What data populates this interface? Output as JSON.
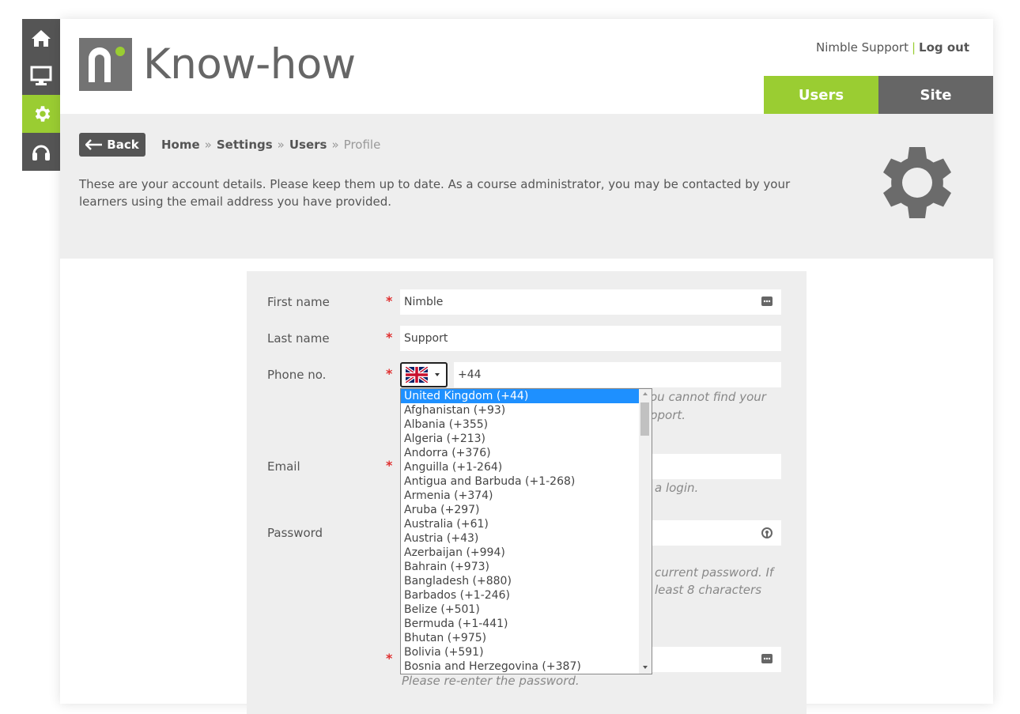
{
  "sidebar": {
    "items": [
      {
        "icon": "home-icon"
      },
      {
        "icon": "monitor-icon"
      },
      {
        "icon": "gear-icon",
        "active": true
      },
      {
        "icon": "headset-icon"
      }
    ]
  },
  "header": {
    "logo_text": "Know-how",
    "user_name": "Nimble Support",
    "separator": "|",
    "logout_label": "Log out",
    "tabs": [
      {
        "label": "Users",
        "active": true
      },
      {
        "label": "Site"
      }
    ]
  },
  "banner": {
    "back_label": "Back",
    "breadcrumb": {
      "home": "Home",
      "settings": "Settings",
      "users": "Users",
      "profile": "Profile",
      "sep": "»"
    },
    "intro": "These are your account details. Please keep them up to date. As a course administrator, you may be contacted by your learners using the email address you have provided."
  },
  "form": {
    "first_name": {
      "label": "First name",
      "value": "Nimble"
    },
    "last_name": {
      "label": "Last name",
      "value": "Support"
    },
    "phone": {
      "label": "Phone no.",
      "value": "+44",
      "help_1": "ou cannot find your",
      "help_2": "pport."
    },
    "email": {
      "label": "Email",
      "help": "a login."
    },
    "password": {
      "label": "Password",
      "help_1": "current password. If",
      "help_2": "least 8 characters"
    },
    "confirm": {
      "help": "Please re-enter the password."
    },
    "required_mark": "*"
  },
  "country_dropdown": {
    "options": [
      "United Kingdom (+44)",
      "Afghanistan (+93)",
      "Albania (+355)",
      "Algeria (+213)",
      "Andorra (+376)",
      "Anguilla (+1-264)",
      "Antigua and Barbuda (+1-268)",
      "Armenia (+374)",
      "Aruba (+297)",
      "Australia (+61)",
      "Austria (+43)",
      "Azerbaijan (+994)",
      "Bahrain (+973)",
      "Bangladesh (+880)",
      "Barbados (+1-246)",
      "Belize (+501)",
      "Bermuda (+1-441)",
      "Bhutan (+975)",
      "Bolivia (+591)",
      "Bosnia and Herzegovina (+387)"
    ],
    "selected_index": 0
  },
  "colors": {
    "accent": "#9acd32",
    "dark": "#555555",
    "panel": "#eeeeee",
    "required": "#e03030",
    "selection": "#1e90ff"
  }
}
